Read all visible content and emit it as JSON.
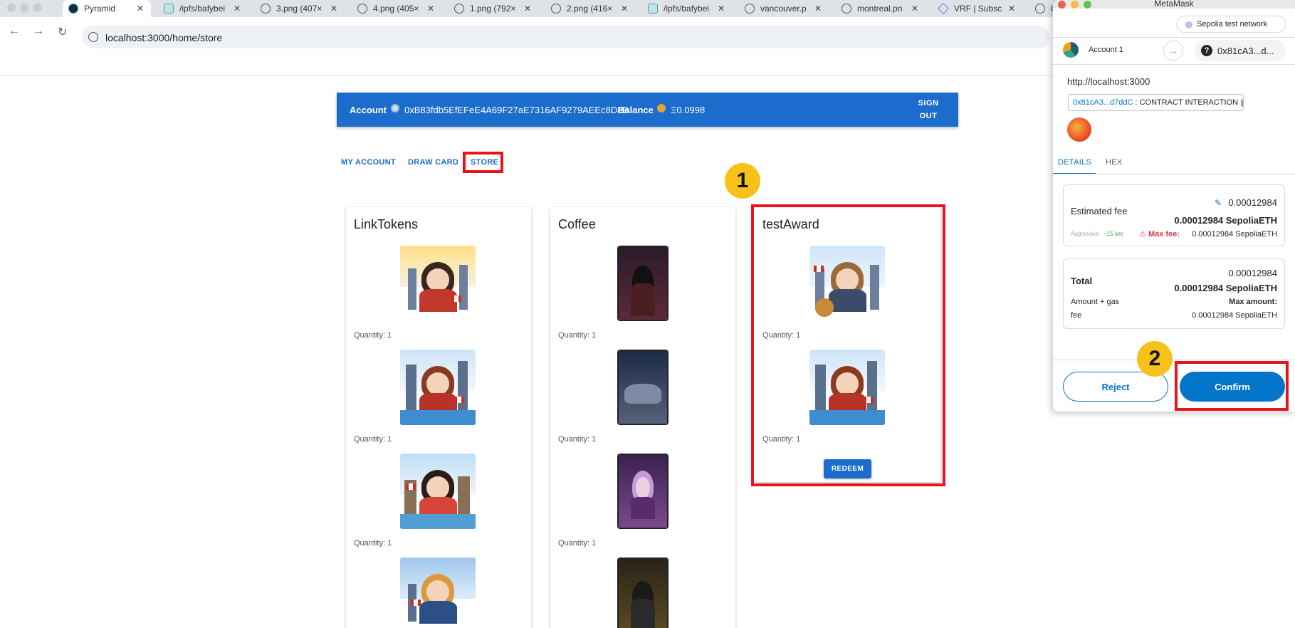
{
  "browser": {
    "tabs": [
      {
        "label": "Pyramid",
        "active": true
      },
      {
        "label": "/ipfs/bafybei"
      },
      {
        "label": "3.png (407×"
      },
      {
        "label": "4.png (405×"
      },
      {
        "label": "1.png (792×"
      },
      {
        "label": "2.png (416×"
      },
      {
        "label": "/ipfs/bafybei"
      },
      {
        "label": "vancouver.p"
      },
      {
        "label": "montreal.pn"
      },
      {
        "label": "VRF | Subsc"
      },
      {
        "label": "C"
      }
    ],
    "url": "localhost:3000/home/store"
  },
  "header": {
    "account_label": "Account",
    "account_address": "0xB83fdb5EfEFeE4A69F27aE7316AF9279AEEc8D8B",
    "balance_label": "Balance",
    "balance_value": "Ξ0.0998",
    "sign_out_line1": "SIGN",
    "sign_out_line2": "OUT"
  },
  "nav": {
    "my_account": "MY ACCOUNT",
    "draw_card": "DRAW CARD",
    "store": "STORE"
  },
  "cards": [
    {
      "title": "LinkTokens",
      "quantities": [
        "Quantity: 1",
        "Quantity: 1",
        "Quantity: 1"
      ]
    },
    {
      "title": "Coffee",
      "quantities": [
        "Quantity: 1",
        "Quantity: 1",
        "Quantity: 1"
      ]
    },
    {
      "title": "testAward",
      "quantities": [
        "Quantity: 1",
        "Quantity: 1"
      ],
      "redeem_label": "REDEEM"
    }
  ],
  "annotations": {
    "step1": "1",
    "step2": "2"
  },
  "metamask": {
    "title": "MetaMask",
    "network": "Sepolia test network",
    "account_name": "Account 1",
    "to_address": "0x81cA3...d...",
    "origin": "http://localhost:3000",
    "contract_address": "0x81cA3...d7ddC",
    "contract_label": ": CONTRACT INTERACTION",
    "tabs": {
      "details": "DETAILS",
      "hex": "HEX"
    },
    "estimated_fee": {
      "label": "Estimated fee",
      "fiat_like": "0.00012984",
      "amount": "0.00012984 SepoliaETH",
      "speed": "Aggressive",
      "time": "~15 sec",
      "max_fee_label": "Max fee:",
      "max_fee_value": "0.00012984 SepoliaETH"
    },
    "total": {
      "label": "Total",
      "fiat_like": "0.00012984",
      "amount": "0.00012984 SepoliaETH",
      "sub_label_1": "Amount + gas",
      "sub_label_2": "fee",
      "max_amount_label": "Max amount:",
      "max_amount_value": "0.00012984 SepoliaETH"
    },
    "reject_label": "Reject",
    "confirm_label": "Confirm"
  },
  "colors": {
    "app_blue": "#1b6ccc",
    "highlight_red": "#e8141b",
    "badge_yellow": "#f6c21a",
    "metamask_blue": "#0376c9"
  }
}
